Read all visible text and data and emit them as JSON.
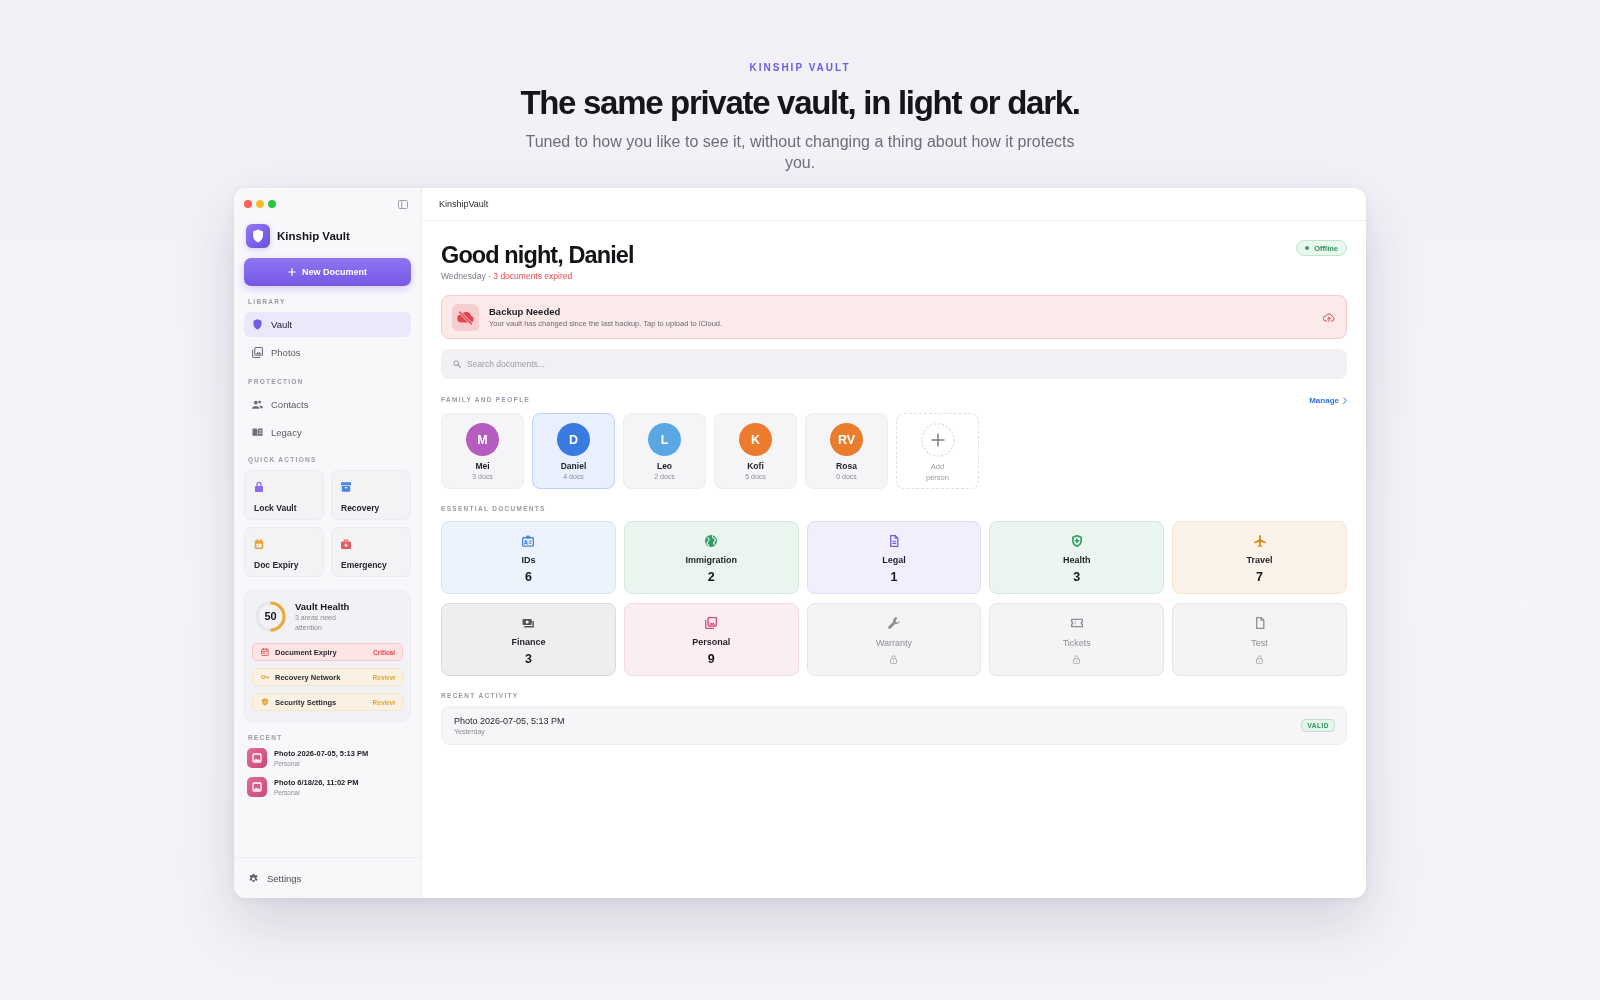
{
  "hero": {
    "eyebrow": "KINSHIP VAULT",
    "title": "The same private vault, in light or dark.",
    "subtitle": "Tuned to how you like to see it, without changing a thing about how it protects you."
  },
  "sidebar": {
    "app_name": "Kinship Vault",
    "new_button": "New Document",
    "nav_sections": [
      {
        "title": "LIBRARY",
        "items": [
          {
            "label": "Vault",
            "selected": true
          },
          {
            "label": "Photos",
            "selected": false
          }
        ]
      },
      {
        "title": "PROTECTION",
        "items": [
          {
            "label": "Contacts",
            "selected": false
          },
          {
            "label": "Legacy",
            "selected": false
          }
        ]
      }
    ],
    "quick_actions": {
      "title": "QUICK ACTIONS",
      "items": [
        {
          "label": "Lock Vault",
          "color": "#8b6cf0"
        },
        {
          "label": "Recovery",
          "color": "#4a84e8"
        },
        {
          "label": "Doc Expiry",
          "color": "#e8a33a"
        },
        {
          "label": "Emergency",
          "color": "#e35d5d"
        }
      ]
    },
    "vault_health": {
      "score": "50",
      "level": 0.5,
      "title": "Vault Health",
      "subtitle": "3 areas need attention",
      "items": [
        {
          "label": "Document Expiry",
          "status": "Critical",
          "kind": "critical"
        },
        {
          "label": "Recovery Network",
          "status": "Review",
          "kind": "review"
        },
        {
          "label": "Security Settings",
          "status": "Review",
          "kind": "review"
        }
      ]
    },
    "recent": {
      "title": "RECENT",
      "items": [
        {
          "title": "Photo 2026-07-05, 5:13 PM",
          "category": "Personal"
        },
        {
          "title": "Photo 6/18/26, 11:02 PM",
          "category": "Personal"
        }
      ]
    },
    "settings": "Settings"
  },
  "main": {
    "toolbar_title": "KinshipVault",
    "greeting": "Good night, Daniel",
    "day": "Wednesday",
    "separator": "·",
    "expired_notice": "3 documents expired",
    "status": "Offline",
    "banner": {
      "title": "Backup Needed",
      "message": "Your vault has changed since the last backup. Tap to upload to iCloud."
    },
    "search": {
      "placeholder": "Search documents..."
    },
    "family": {
      "title": "FAMILY AND PEOPLE",
      "action": "Manage",
      "people": [
        {
          "initials": "M",
          "name": "Mei",
          "docs": "3 docs",
          "color": "#b65cc0",
          "selected": false
        },
        {
          "initials": "D",
          "name": "Daniel",
          "docs": "4 docs",
          "color": "#3a7be2",
          "selected": true
        },
        {
          "initials": "L",
          "name": "Leo",
          "docs": "2 docs",
          "color": "#5aa7e6",
          "selected": false
        },
        {
          "initials": "K",
          "name": "Kofi",
          "docs": "5 docs",
          "color": "#ec7b2d",
          "selected": false
        },
        {
          "initials": "RV",
          "name": "Rosa",
          "docs": "0 docs",
          "color": "#ea7d2c",
          "selected": false
        }
      ],
      "add_label": "Add person"
    },
    "documents": {
      "title": "ESSENTIAL DOCUMENTS",
      "items": [
        {
          "label": "IDs",
          "count": "6",
          "color": "#4a84e8",
          "locked": false
        },
        {
          "label": "Immigration",
          "count": "2",
          "color": "#2f9e63",
          "locked": false
        },
        {
          "label": "Legal",
          "count": "1",
          "color": "#7a5ae8",
          "locked": false
        },
        {
          "label": "Health",
          "count": "3",
          "color": "#2f9e63",
          "locked": false
        },
        {
          "label": "Travel",
          "count": "7",
          "color": "#d98a1e",
          "locked": false
        },
        {
          "label": "Finance",
          "count": "3",
          "color": "#55555f",
          "locked": false
        },
        {
          "label": "Personal",
          "count": "9",
          "color": "#d9507b",
          "locked": false
        },
        {
          "label": "Warranty",
          "color": "#8e8e98",
          "locked": true
        },
        {
          "label": "Tickets",
          "color": "#8e8e98",
          "locked": true
        },
        {
          "label": "Test",
          "color": "#8e8e98",
          "locked": true
        }
      ]
    },
    "recent_activity": {
      "title": "RECENT ACTIVITY",
      "items": [
        {
          "title": "Photo 2026-07-05, 5:13 PM",
          "time": "Yesterday",
          "badge": "VALID"
        }
      ]
    }
  }
}
